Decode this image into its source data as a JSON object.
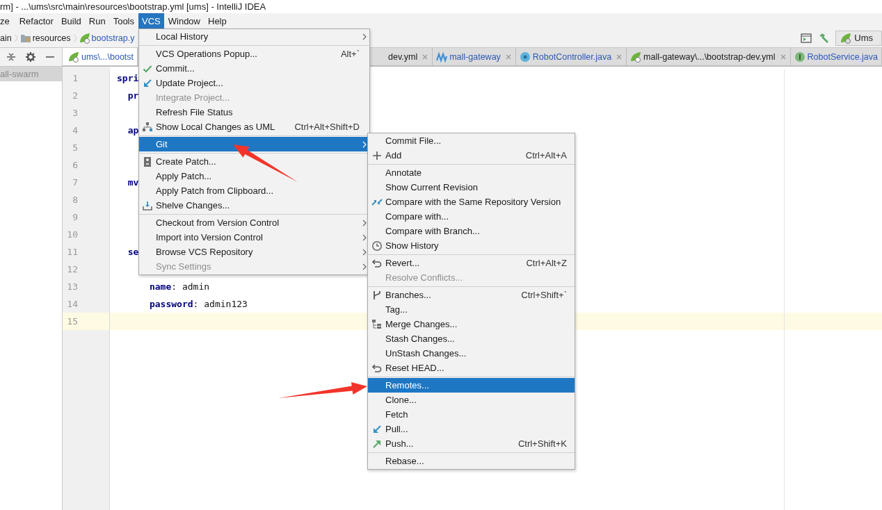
{
  "window": {
    "title": "rm] - ...\\ums\\src\\main\\resources\\bootstrap.yml [ums] - IntelliJ IDEA"
  },
  "menu_bar": [
    {
      "label": "ze",
      "selected": false
    },
    {
      "label": "Refactor",
      "selected": false
    },
    {
      "label": "Build",
      "selected": false
    },
    {
      "label": "Run",
      "selected": false
    },
    {
      "label": "Tools",
      "selected": false
    },
    {
      "label": "VCS",
      "selected": true
    },
    {
      "label": "Window",
      "selected": false
    },
    {
      "label": "Help",
      "selected": false
    }
  ],
  "nav_bar": {
    "crumbs": [
      {
        "label": "ain",
        "kind": "plain"
      },
      {
        "label": "resources",
        "kind": "folder"
      },
      {
        "label": "bootstrap.y",
        "kind": "spring"
      }
    ],
    "run_config": "Ums"
  },
  "project_panel": {
    "items": [
      {
        "label": "all-swarm",
        "selected": true
      }
    ]
  },
  "editor_tabs": [
    {
      "label": "ums\\...\\bootst",
      "kind": "spring",
      "selected": true,
      "modified": true
    },
    {
      "label": "dev.yml",
      "kind": "none",
      "selected": false,
      "modified": false,
      "closable": true
    },
    {
      "label": "mall-gateway",
      "kind": "maven",
      "selected": false,
      "modified": true,
      "closable": true
    },
    {
      "label": "RobotController.java",
      "kind": "class",
      "selected": false,
      "modified": true,
      "closable": true
    },
    {
      "label": "mall-gateway\\...\\bootstrap-dev.yml",
      "kind": "spring",
      "selected": false,
      "modified": false,
      "closable": true
    },
    {
      "label": "RobotService.java",
      "kind": "interface",
      "selected": false,
      "modified": true
    }
  ],
  "editor": {
    "lines": [
      {
        "number": "1",
        "code": "**spri**",
        "current": false
      },
      {
        "number": "2",
        "code": "  **pr**",
        "current": false
      },
      {
        "number": "3",
        "current": false
      },
      {
        "number": "4",
        "code": "  **ap**",
        "current": false
      },
      {
        "number": "5",
        "current": false
      },
      {
        "number": "6",
        "current": false
      },
      {
        "number": "7",
        "code": "  **mv**",
        "current": false
      },
      {
        "number": "8",
        "current": false
      },
      {
        "number": "9",
        "current": false
      },
      {
        "number": "10",
        "current": false
      },
      {
        "number": "11",
        "code": "  **se**",
        "current": false
      },
      {
        "number": "12",
        "current": false
      },
      {
        "number": "13",
        "code": "      **name**: admin",
        "current": false
      },
      {
        "number": "14",
        "code": "      **password**: admin123",
        "current": false
      },
      {
        "number": "15",
        "current": true
      }
    ]
  },
  "vcs_menu": {
    "groups": [
      {
        "items": [
          {
            "label": "Local History",
            "kind": "plain",
            "selected": false,
            "disabled": false,
            "submenu": true
          }
        ]
      },
      {
        "items": [
          {
            "label": "VCS Operations Popup...",
            "shortcut": "Alt+`",
            "kind": "plain",
            "selected": false,
            "disabled": false,
            "submenu": false
          },
          {
            "label": "Commit...",
            "kind": "check",
            "selected": false,
            "disabled": false,
            "submenu": false
          },
          {
            "label": "Update Project...",
            "kind": "update",
            "selected": false,
            "disabled": false,
            "submenu": false
          },
          {
            "label": "Integrate Project...",
            "kind": "plain",
            "selected": false,
            "disabled": true,
            "submenu": false
          },
          {
            "label": "Refresh File Status",
            "kind": "plain",
            "selected": false,
            "disabled": false,
            "submenu": false
          },
          {
            "label": "Show Local Changes as UML",
            "shortcut": "Ctrl+Alt+Shift+D",
            "kind": "uml",
            "selected": false,
            "disabled": false,
            "submenu": false
          }
        ]
      },
      {
        "items": [
          {
            "label": "Git",
            "kind": "plain",
            "selected": true,
            "disabled": false,
            "submenu": true
          }
        ]
      },
      {
        "items": [
          {
            "label": "Create Patch...",
            "kind": "patch",
            "selected": false,
            "disabled": false,
            "submenu": false
          },
          {
            "label": "Apply Patch...",
            "kind": "plain",
            "selected": false,
            "disabled": false,
            "submenu": false
          },
          {
            "label": "Apply Patch from Clipboard...",
            "kind": "plain",
            "selected": false,
            "disabled": false,
            "submenu": false
          },
          {
            "label": "Shelve Changes...",
            "kind": "shelve",
            "selected": false,
            "disabled": false,
            "submenu": false
          }
        ]
      },
      {
        "items": [
          {
            "label": "Checkout from Version Control",
            "kind": "plain",
            "selected": false,
            "disabled": false,
            "submenu": true
          },
          {
            "label": "Import into Version Control",
            "kind": "plain",
            "selected": false,
            "disabled": false,
            "submenu": true
          },
          {
            "label": "Browse VCS Repository",
            "kind": "plain",
            "selected": false,
            "disabled": false,
            "submenu": true
          },
          {
            "label": "Sync Settings",
            "kind": "plain",
            "selected": false,
            "disabled": true,
            "submenu": true
          }
        ]
      }
    ]
  },
  "git_submenu": {
    "groups": [
      {
        "items": [
          {
            "label": "Commit File...",
            "kind": "plain",
            "selected": false,
            "disabled": false,
            "submenu": false
          },
          {
            "label": "Add",
            "shortcut": "Ctrl+Alt+A",
            "kind": "add",
            "selected": false,
            "disabled": false,
            "submenu": false
          }
        ]
      },
      {
        "items": [
          {
            "label": "Annotate",
            "kind": "plain",
            "selected": false,
            "disabled": false,
            "submenu": false
          },
          {
            "label": "Show Current Revision",
            "kind": "plain",
            "selected": false,
            "disabled": false,
            "submenu": false
          },
          {
            "label": "Compare with the Same Repository Version",
            "kind": "compare",
            "selected": false,
            "disabled": false,
            "submenu": false
          },
          {
            "label": "Compare with...",
            "kind": "plain",
            "selected": false,
            "disabled": false,
            "submenu": false
          },
          {
            "label": "Compare with Branch...",
            "kind": "plain",
            "selected": false,
            "disabled": false,
            "submenu": false
          },
          {
            "label": "Show History",
            "kind": "history",
            "selected": false,
            "disabled": false,
            "submenu": false
          }
        ]
      },
      {
        "items": [
          {
            "label": "Revert...",
            "shortcut": "Ctrl+Alt+Z",
            "kind": "revert",
            "selected": false,
            "disabled": false,
            "submenu": false
          },
          {
            "label": "Resolve Conflicts...",
            "kind": "plain",
            "selected": false,
            "disabled": true,
            "submenu": false
          }
        ]
      },
      {
        "items": [
          {
            "label": "Branches...",
            "shortcut": "Ctrl+Shift+`",
            "kind": "branches",
            "selected": false,
            "disabled": false,
            "submenu": false
          },
          {
            "label": "Tag...",
            "kind": "plain",
            "selected": false,
            "disabled": false,
            "submenu": false
          },
          {
            "label": "Merge Changes...",
            "kind": "merge",
            "selected": false,
            "disabled": false,
            "submenu": false
          },
          {
            "label": "Stash Changes...",
            "kind": "plain",
            "selected": false,
            "disabled": false,
            "submenu": false
          },
          {
            "label": "UnStash Changes...",
            "kind": "plain",
            "selected": false,
            "disabled": false,
            "submenu": false
          },
          {
            "label": "Reset HEAD...",
            "kind": "revert",
            "selected": false,
            "disabled": false,
            "submenu": false
          }
        ]
      },
      {
        "items": [
          {
            "label": "Remotes...",
            "kind": "plain",
            "selected": true,
            "disabled": false,
            "submenu": false
          },
          {
            "label": "Clone...",
            "kind": "plain",
            "selected": false,
            "disabled": false,
            "submenu": false
          },
          {
            "label": "Fetch",
            "kind": "plain",
            "selected": false,
            "disabled": false,
            "submenu": false
          },
          {
            "label": "Pull...",
            "kind": "pull",
            "selected": false,
            "disabled": false,
            "submenu": false
          },
          {
            "label": "Push...",
            "shortcut": "Ctrl+Shift+K",
            "kind": "push",
            "selected": false,
            "disabled": false,
            "submenu": false
          }
        ]
      },
      {
        "items": [
          {
            "label": "Rebase...",
            "kind": "plain",
            "selected": false,
            "disabled": false,
            "submenu": false
          }
        ]
      }
    ]
  }
}
